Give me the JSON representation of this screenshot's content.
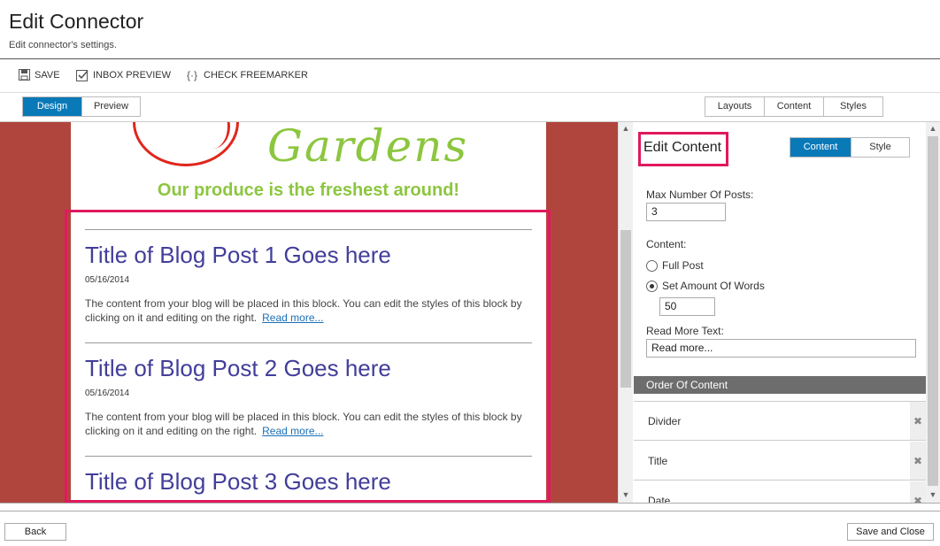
{
  "header": {
    "title": "Edit Connector",
    "subtitle": "Edit connector's settings."
  },
  "toolbar": {
    "save_label": "SAVE",
    "inbox_preview_label": "INBOX PREVIEW",
    "check_freemarker_label": "CHECK FREEMARKER"
  },
  "view_tabs": {
    "design": "Design",
    "preview": "Preview",
    "active": "Design"
  },
  "panel_tabs": {
    "layouts": "Layouts",
    "content": "Content",
    "styles": "Styles"
  },
  "email": {
    "brand_text": "Gardens",
    "tagline": "Our produce is the freshest around!",
    "posts": [
      {
        "title": "Title of Blog Post 1 Goes here",
        "date": "05/16/2014",
        "body": "The content from your blog will be placed in this block. You can edit the styles of this block by clicking on it and editing on the right.",
        "read_more": "Read more..."
      },
      {
        "title": "Title of Blog Post 2 Goes here",
        "date": "05/16/2014",
        "body": "The content from your blog will be placed in this block. You can edit the styles of this block by clicking on it and editing on the right.",
        "read_more": "Read more..."
      },
      {
        "title": "Title of Blog Post 3 Goes here"
      }
    ]
  },
  "edit_panel": {
    "title": "Edit Content",
    "tabs": {
      "content": "Content",
      "style": "Style",
      "active": "Content"
    },
    "max_posts_label": "Max Number Of Posts:",
    "max_posts_value": "3",
    "content_label": "Content:",
    "radio_full_post": "Full Post",
    "radio_set_amount": "Set Amount Of Words",
    "selected_radio": "Set Amount Of Words",
    "words_value": "50",
    "read_more_label": "Read More Text:",
    "read_more_value": "Read more...",
    "order_header": "Order Of Content",
    "order_items": [
      "Divider",
      "Title",
      "Date"
    ]
  },
  "footer": {
    "back_label": "Back",
    "save_close_label": "Save and Close"
  },
  "colors": {
    "accent": "#0a79b8",
    "canvas_bg": "#b0453e",
    "highlight": "#e0195e",
    "brand_green": "#8cc63f",
    "post_title": "#423e9a"
  }
}
